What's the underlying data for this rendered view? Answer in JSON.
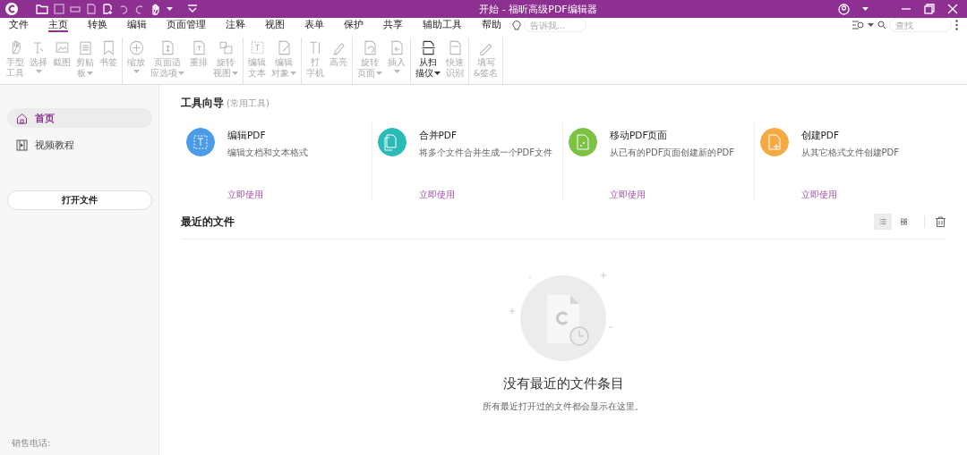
{
  "window": {
    "title": "开始 - 福昕高级PDF编辑器"
  },
  "menu_tabs": [
    {
      "label": "文件",
      "selected": false
    },
    {
      "label": "主页",
      "selected": true
    },
    {
      "label": "转换",
      "selected": false
    },
    {
      "label": "编辑",
      "selected": false
    },
    {
      "label": "页面管理",
      "selected": false
    },
    {
      "label": "注释",
      "selected": false
    },
    {
      "label": "视图",
      "selected": false
    },
    {
      "label": "表单",
      "selected": false
    },
    {
      "label": "保护",
      "selected": false
    },
    {
      "label": "共享",
      "selected": false
    },
    {
      "label": "辅助工具",
      "selected": false
    },
    {
      "label": "帮助",
      "selected": false
    }
  ],
  "tell_me": {
    "placeholder": "告诉我..."
  },
  "find": {
    "placeholder": "查找"
  },
  "ribbon_groups": [
    {
      "tools": [
        {
          "lines": [
            "手型",
            "工具"
          ],
          "dropdown": false,
          "disabled": true
        },
        {
          "lines": [
            "选择"
          ],
          "dropdown": true,
          "disabled": true
        },
        {
          "lines": [
            "截图"
          ],
          "dropdown": false,
          "disabled": true
        },
        {
          "lines": [
            "剪贴",
            "板"
          ],
          "dropdown": true,
          "disabled": true
        },
        {
          "lines": [
            "书签"
          ],
          "dropdown": false,
          "disabled": true
        }
      ]
    },
    {
      "tools": [
        {
          "lines": [
            "缩放"
          ],
          "dropdown": true,
          "disabled": true
        },
        {
          "lines": [
            "页面适",
            "应选项"
          ],
          "dropdown": true,
          "disabled": true
        },
        {
          "lines": [
            "重排"
          ],
          "dropdown": false,
          "disabled": true
        },
        {
          "lines": [
            "旋转",
            "视图"
          ],
          "dropdown": true,
          "disabled": true
        }
      ]
    },
    {
      "tools": [
        {
          "lines": [
            "编辑",
            "文本"
          ],
          "dropdown": false,
          "disabled": true
        },
        {
          "lines": [
            "编辑",
            "对象"
          ],
          "dropdown": true,
          "disabled": true
        }
      ]
    },
    {
      "tools": [
        {
          "lines": [
            "打",
            "字机"
          ],
          "dropdown": false,
          "disabled": true
        },
        {
          "lines": [
            "高亮"
          ],
          "dropdown": false,
          "disabled": true
        }
      ]
    },
    {
      "tools": [
        {
          "lines": [
            "旋转",
            "页面"
          ],
          "dropdown": true,
          "disabled": true
        },
        {
          "lines": [
            "插入"
          ],
          "dropdown": true,
          "disabled": true
        }
      ]
    },
    {
      "tools": [
        {
          "lines": [
            "从扫",
            "描仪"
          ],
          "dropdown": true,
          "disabled": false
        },
        {
          "lines": [
            "快速",
            "识别"
          ],
          "dropdown": false,
          "disabled": true
        }
      ]
    },
    {
      "tools": [
        {
          "lines": [
            "填写",
            "&签名"
          ],
          "dropdown": false,
          "disabled": true
        }
      ]
    }
  ],
  "sidebar": {
    "items": [
      {
        "label": "首页",
        "selected": true
      },
      {
        "label": "视频教程",
        "selected": false
      }
    ],
    "open_button": "打开文件",
    "footer": "销售电话:"
  },
  "tool_guide": {
    "title": "工具向导",
    "subtitle": "(常用工具)",
    "cards": [
      {
        "title": "编辑PDF",
        "description": "编辑文档和文本格式",
        "link": "立即使用",
        "color": "#4a9be8"
      },
      {
        "title": "合并PDF",
        "description": "将多个文件合并生成一个PDF文件",
        "link": "立即使用",
        "color": "#2bbbb6"
      },
      {
        "title": "移动PDF页面",
        "description": "从已有的PDF页面创建新的PDF",
        "link": "立即使用",
        "color": "#7cc243"
      },
      {
        "title": "创建PDF",
        "description": "从其它格式文件创建PDF",
        "link": "立即使用",
        "color": "#f5a942"
      }
    ]
  },
  "recent": {
    "title": "最近的文件",
    "view_modes": [
      {
        "kind": "list",
        "selected": true
      },
      {
        "kind": "grid",
        "selected": false
      }
    ],
    "empty_title": "没有最近的文件条目",
    "empty_text": "所有最近打开过的文件都会显示在这里。"
  }
}
